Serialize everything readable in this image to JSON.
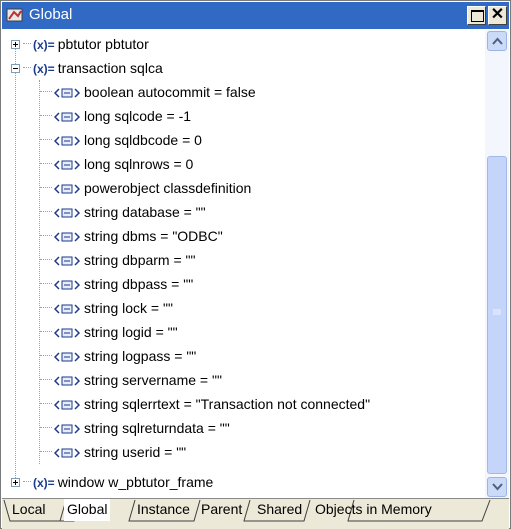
{
  "window": {
    "title": "Global"
  },
  "tree": {
    "top_items": [
      {
        "label": "pbtutor pbtutor",
        "expanded": false
      },
      {
        "label": "transaction sqlca",
        "expanded": true
      },
      {
        "label": "window w_pbtutor_frame",
        "expanded": false
      }
    ],
    "var_icon_text": "(x)=",
    "children": [
      "boolean autocommit = false",
      "long sqlcode = -1",
      "long sqldbcode = 0",
      "long sqlnrows = 0",
      "powerobject classdefinition",
      "string database = \"\"",
      "string dbms = \"ODBC\"",
      "string dbparm = \"\"",
      "string dbpass = \"\"",
      "string lock = \"\"",
      "string logid = \"\"",
      "string logpass = \"\"",
      "string servername = \"\"",
      "string sqlerrtext = \"Transaction not connected\"",
      "string sqlreturndata = \"\"",
      "string userid = \"\""
    ]
  },
  "scrollbar": {
    "position_fraction": 0.26,
    "visible_fraction": 0.68
  },
  "tabs": [
    "Local",
    "Global",
    "Instance",
    "Parent",
    "Shared",
    "Objects in Memory"
  ],
  "active_tab": "Global",
  "colors": {
    "titlebar": "#316ac5",
    "tab_strip": "#ece9d8",
    "var_icon": "#1a3a8c"
  }
}
